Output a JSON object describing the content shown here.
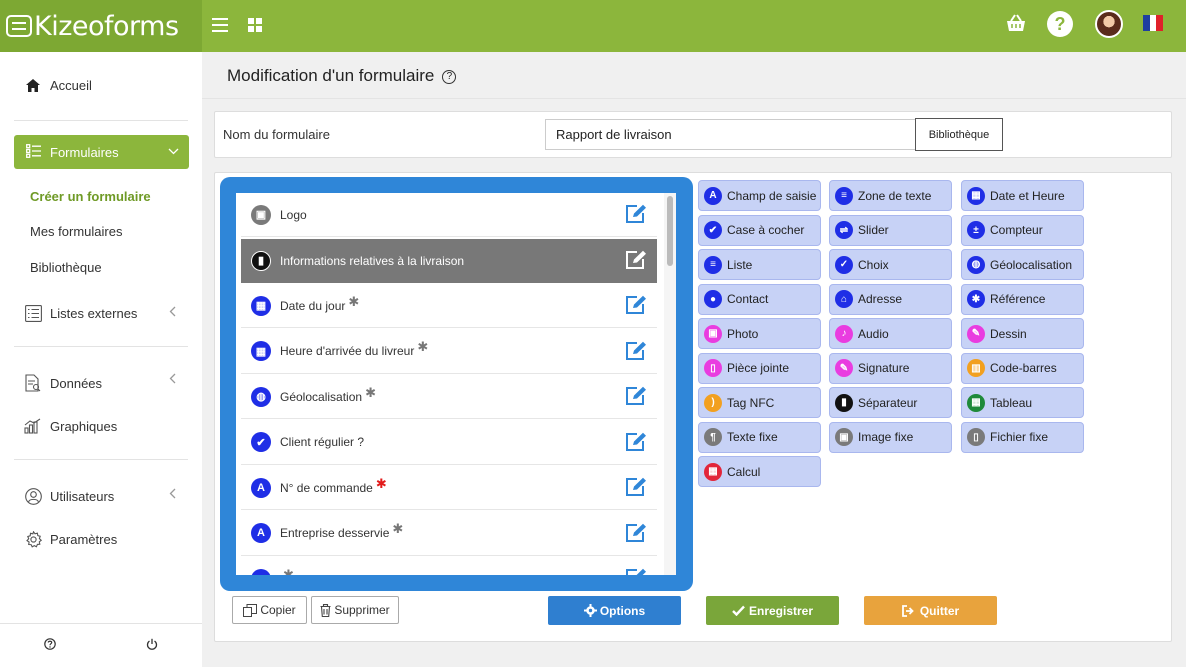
{
  "app": {
    "logo_text": "Kizeoforms",
    "colors": {
      "brand": "#8cb63c",
      "brand_dark": "#7da833",
      "accent_blue": "#2f86d8",
      "options": "#2f7fd0",
      "save": "#7aa63a",
      "quit": "#e8a33d"
    }
  },
  "topbar": {
    "help_glyph": "?",
    "flag": "fr"
  },
  "sidebar": {
    "home": "Accueil",
    "forms": "Formulaires",
    "forms_sub": [
      "Créer un formulaire",
      "Mes formulaires",
      "Bibliothèque"
    ],
    "external_lists": "Listes externes",
    "data": "Données",
    "charts": "Graphiques",
    "users": "Utilisateurs",
    "settings": "Paramètres"
  },
  "page": {
    "title": "Modification d'un formulaire",
    "help_glyph": "?"
  },
  "form_name": {
    "label": "Nom du formulaire",
    "value": "Rapport de livraison",
    "library_button": "Bibliothèque"
  },
  "fields": [
    {
      "label": "Logo",
      "icon": "image-icon",
      "color": "#7a7a7a",
      "glyph": "▣",
      "mark": "",
      "dark": false
    },
    {
      "label": "Informations relatives à la livraison",
      "icon": "bookmark-icon",
      "color": "#111111",
      "glyph": "▮",
      "mark": "",
      "dark": true
    },
    {
      "label": "Date du jour",
      "icon": "calendar-icon",
      "color": "#1f2ee6",
      "glyph": "▦",
      "mark": "✱",
      "dark": false
    },
    {
      "label": "Heure d'arrivée du livreur",
      "icon": "calendar-icon",
      "color": "#1f2ee6",
      "glyph": "▦",
      "mark": "✱",
      "dark": false
    },
    {
      "label": "Géolocalisation",
      "icon": "globe-icon",
      "color": "#1f2ee6",
      "glyph": "◍",
      "mark": "✱",
      "dark": false
    },
    {
      "label": "Client régulier ?",
      "icon": "checkbox-icon",
      "color": "#1f2ee6",
      "glyph": "✔",
      "mark": "",
      "dark": false
    },
    {
      "label": "N° de commande",
      "icon": "text-field-icon",
      "color": "#1f2ee6",
      "glyph": "A",
      "mark": "✱",
      "required": true,
      "dark": false
    },
    {
      "label": "Entreprise desservie",
      "icon": "text-field-icon",
      "color": "#1f2ee6",
      "glyph": "A",
      "mark": "✱",
      "dark": false
    },
    {
      "label": "",
      "icon": "list-icon",
      "color": "#1f2ee6",
      "glyph": "≡",
      "mark": "✱",
      "dark": false
    }
  ],
  "controls": [
    [
      {
        "label": "Champ de saisie",
        "icon": "text-field-icon",
        "color": "#1f2ee6",
        "glyph": "A"
      },
      {
        "label": "Case à cocher",
        "icon": "checkbox-icon",
        "color": "#1f2ee6",
        "glyph": "✔"
      },
      {
        "label": "Liste",
        "icon": "list-icon",
        "color": "#1f2ee6",
        "glyph": "≡"
      },
      {
        "label": "Contact",
        "icon": "person-icon",
        "color": "#1f2ee6",
        "glyph": "●"
      },
      {
        "label": "Photo",
        "icon": "photo-icon",
        "color": "#e93ce0",
        "glyph": "▣"
      },
      {
        "label": "Pièce jointe",
        "icon": "attachment-icon",
        "color": "#e93ce0",
        "glyph": "▯"
      },
      {
        "label": "Tag NFC",
        "icon": "nfc-icon",
        "color": "#f2a020",
        "glyph": ")"
      },
      {
        "label": "Texte fixe",
        "icon": "paragraph-icon",
        "color": "#7a7a7a",
        "glyph": "¶"
      },
      {
        "label": "Calcul",
        "icon": "calculator-icon",
        "color": "#e2263a",
        "glyph": "▦"
      }
    ],
    [
      {
        "label": "Zone de texte",
        "icon": "textarea-icon",
        "color": "#1f2ee6",
        "glyph": "≡"
      },
      {
        "label": "Slider",
        "icon": "slider-icon",
        "color": "#1f2ee6",
        "glyph": "⇌"
      },
      {
        "label": "Choix",
        "icon": "choice-icon",
        "color": "#1f2ee6",
        "glyph": "✓"
      },
      {
        "label": "Adresse",
        "icon": "home-icon",
        "color": "#1f2ee6",
        "glyph": "⌂"
      },
      {
        "label": "Audio",
        "icon": "microphone-icon",
        "color": "#e93ce0",
        "glyph": "♪"
      },
      {
        "label": "Signature",
        "icon": "signature-icon",
        "color": "#e93ce0",
        "glyph": "✎"
      },
      {
        "label": "Séparateur",
        "icon": "bookmark-icon",
        "color": "#111111",
        "glyph": "▮"
      },
      {
        "label": "Image fixe",
        "icon": "image-icon",
        "color": "#7a7a7a",
        "glyph": "▣"
      }
    ],
    [
      {
        "label": "Date et Heure",
        "icon": "calendar-icon",
        "color": "#1f2ee6",
        "glyph": "▦"
      },
      {
        "label": "Compteur",
        "icon": "counter-icon",
        "color": "#1f2ee6",
        "glyph": "±"
      },
      {
        "label": "Géolocalisation",
        "icon": "globe-icon",
        "color": "#1f2ee6",
        "glyph": "◍"
      },
      {
        "label": "Référence",
        "icon": "reference-icon",
        "color": "#1f2ee6",
        "glyph": "✱"
      },
      {
        "label": "Dessin",
        "icon": "brush-icon",
        "color": "#e93ce0",
        "glyph": "✎"
      },
      {
        "label": "Code-barres",
        "icon": "barcode-icon",
        "color": "#f2a020",
        "glyph": "▥"
      },
      {
        "label": "Tableau",
        "icon": "table-icon",
        "color": "#1f8a3a",
        "glyph": "▦"
      },
      {
        "label": "Fichier fixe",
        "icon": "file-icon",
        "color": "#7a7a7a",
        "glyph": "▯"
      }
    ]
  ],
  "actions": {
    "copy": "Copier",
    "delete": "Supprimer",
    "options": "Options",
    "save": "Enregistrer",
    "quit": "Quitter"
  }
}
